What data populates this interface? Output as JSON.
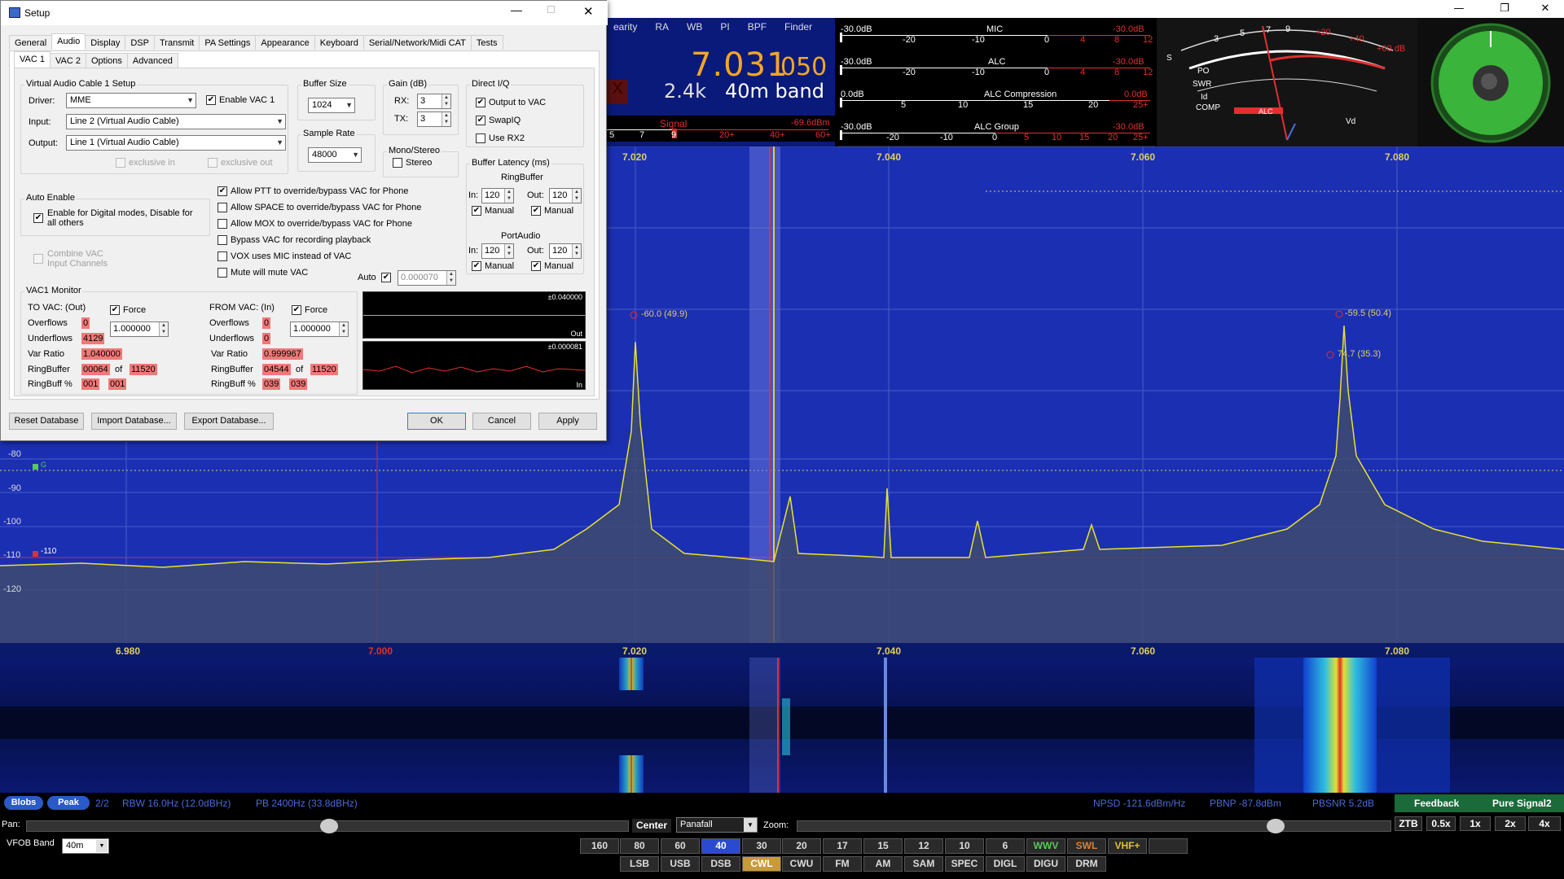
{
  "app": {
    "minimize": "—",
    "maximize": "❐",
    "close": "✕"
  },
  "vfo": {
    "menu": [
      "earity",
      "RA",
      "WB",
      "PI",
      "BPF",
      "Finder"
    ],
    "freq_main": "7.031",
    "freq_sub": "050",
    "bandwidth": "2.4k",
    "band": "40m band",
    "signal_label": "Signal",
    "signal_value": "-69.6dBm",
    "signal_ticks": [
      "5",
      "7",
      "9",
      "20+",
      "40+",
      "60+"
    ]
  },
  "meters": [
    {
      "left": "-30.0dB",
      "center": "MIC",
      "right": "-30.0dB",
      "ticks": [
        "-20",
        "-10",
        "0",
        "4",
        "8",
        "12"
      ]
    },
    {
      "left": "-30.0dB",
      "center": "ALC",
      "right": "-30.0dB",
      "ticks": [
        "-20",
        "-10",
        "0",
        "4",
        "8",
        "12"
      ]
    },
    {
      "left": "0.0dB",
      "center": "ALC Compression",
      "right": "0.0dB",
      "ticks": [
        "5",
        "10",
        "15",
        "20",
        "25+"
      ]
    },
    {
      "left": "-30.0dB",
      "center": "ALC Group",
      "right": "-30.0dB",
      "ticks": [
        "-20",
        "-10",
        "0",
        "5",
        "10",
        "15",
        "20",
        "25+"
      ]
    }
  ],
  "analog": {
    "labels": [
      "S",
      "PO",
      "SWR",
      "Id",
      "COMP",
      "ALC",
      "Vd"
    ],
    "scale": [
      "3",
      "5",
      "7",
      "9",
      "+20",
      "+40",
      "+60 dB"
    ]
  },
  "spectrum": {
    "top_freqs": [
      "7.020",
      "7.040",
      "7.060",
      "7.080"
    ],
    "bottom_freqs": [
      "6.980",
      "7.000",
      "7.020",
      "7.040",
      "7.060",
      "7.080"
    ],
    "db_labels": [
      "-80",
      "-90",
      "-100",
      "-110",
      "-120"
    ],
    "marker_110": "-110",
    "marker_g": "G",
    "peak1": "-60.0 (49.9)",
    "peak2": "-59.5 (50.4)",
    "peak3": "74.7 (35.3)"
  },
  "status": {
    "blobs": "Blobs",
    "peak": "Peak",
    "count": "2/2",
    "rbw": "RBW 16.0Hz (12.0dBHz)",
    "pb": "PB 2400Hz (33.8dBHz)",
    "npsd": "NPSD -121.6dBm/Hz",
    "pbnp": "PBNP -87.8dBm",
    "pbsnr": "PBSNR 5.2dB",
    "feedback": "Feedback",
    "pure_signal": "Pure Signal2"
  },
  "controls": {
    "pan_label": "Pan:",
    "center_btn": "Center",
    "display_mode": "Panafall",
    "zoom_label": "Zoom:",
    "zoom_buttons": [
      "ZTB",
      "0.5x",
      "1x",
      "2x",
      "4x"
    ],
    "vfob_label": "VFOB Band",
    "vfob_value": "40m",
    "band_row1": [
      "160",
      "80",
      "60",
      "40",
      "30",
      "20",
      "17",
      "15",
      "12",
      "10",
      "6",
      "WWV",
      "SWL",
      "VHF+"
    ],
    "mode_row": [
      "LSB",
      "USB",
      "DSB",
      "CWL",
      "CWU",
      "FM",
      "AM",
      "SAM",
      "SPEC",
      "DIGL",
      "DIGU",
      "DRM"
    ]
  },
  "setup": {
    "title": "Setup",
    "tabs_main": [
      "General",
      "Audio",
      "Display",
      "DSP",
      "Transmit",
      "PA Settings",
      "Appearance",
      "Keyboard",
      "Serial/Network/Midi CAT",
      "Tests"
    ],
    "tabs_sub": [
      "VAC 1",
      "VAC 2",
      "Options",
      "Advanced"
    ],
    "vac_group": "Virtual Audio Cable 1 Setup",
    "driver_label": "Driver:",
    "driver_value": "MME",
    "enable_vac1": "Enable VAC 1",
    "input_label": "Input:",
    "input_value": "Line 2 (Virtual Audio Cable)",
    "output_label": "Output:",
    "output_value": "Line 1 (Virtual Audio Cable)",
    "excl_in": "exclusive in",
    "excl_out": "exclusive out",
    "buffer_size_label": "Buffer Size",
    "buffer_size_value": "1024",
    "sample_rate_label": "Sample Rate",
    "sample_rate_value": "48000",
    "gain_label": "Gain (dB)",
    "rx_label": "RX:",
    "rx_value": "3",
    "tx_label": "TX:",
    "tx_value": "3",
    "mono_stereo_label": "Mono/Stereo",
    "stereo": "Stereo",
    "direct_iq": "Direct I/Q",
    "output_to_vac": "Output to VAC",
    "swap_iq": "SwapIQ",
    "use_rx2": "Use RX2",
    "buffer_latency": "Buffer Latency (ms)",
    "ringbuffer": "RingBuffer",
    "portaudio": "PortAudio",
    "in_label": "In:",
    "out_label": "Out:",
    "latency_value": "120",
    "manual": "Manual",
    "auto_enable": "Auto Enable",
    "auto_enable_cb": "Enable for Digital modes, Disable for all others",
    "combine_vac": "Combine VAC Input Channels",
    "opt_ptt": "Allow PTT to override/bypass VAC for Phone",
    "opt_space": "Allow SPACE to override/bypass VAC for Phone",
    "opt_mox": "Allow MOX to override/bypass VAC for Phone",
    "opt_bypass": "Bypass VAC for recording playback",
    "opt_vox": "VOX uses MIC instead of VAC",
    "opt_mute": "Mute will mute VAC",
    "auto_label": "Auto",
    "auto_value": "0.000070",
    "monitor": "VAC1 Monitor",
    "to_vac": "TO VAC: (Out)",
    "from_vac": "FROM VAC: (In)",
    "force": "Force",
    "force_value": "1.000000",
    "overflows": "Overflows",
    "underflows": "Underflows",
    "var_ratio": "Var Ratio",
    "ringbuffer_row": "RingBuffer",
    "ringbuff_pct": "RingBuff %",
    "of": "of",
    "to_overflows": "0",
    "to_underflows": "4129",
    "to_var": "1.040000",
    "to_rb": "00064",
    "to_rb_total": "11520",
    "to_pct_a": "001",
    "to_pct_b": "001",
    "from_overflows": "0",
    "from_underflows": "0",
    "from_var": "0.999967",
    "from_rb": "04544",
    "from_rb_total": "11520",
    "from_pct_a": "039",
    "from_pct_b": "039",
    "scope_out_val": "±0.040000",
    "scope_out": "Out",
    "scope_in_val": "±0.000081",
    "scope_in": "In",
    "reset_db": "Reset Database",
    "import_db": "Import Database...",
    "export_db": "Export Database...",
    "ok": "OK",
    "cancel": "Cancel",
    "apply": "Apply"
  }
}
